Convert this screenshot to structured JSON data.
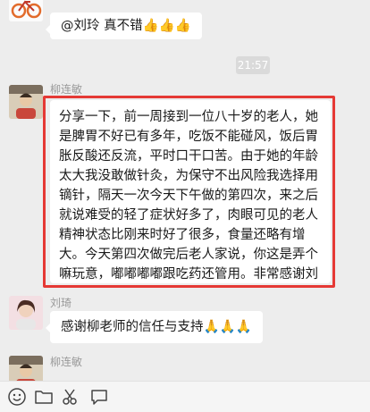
{
  "messages": [
    {
      "sender": "",
      "text": "@刘玲 真不错👍👍👍"
    },
    {
      "sender": "柳连敏",
      "text": "分享一下，前一周接到一位八十岁的老人，她是脾胃不好已有多年，吃饭不能碰风，饭后胃胀反酸还反流，平时口干口苦。由于她的年龄太大我没敢做针灸，为保守不出风险我选择用镝针，隔天一次今天下午做的第四次，来之后就说难受的轻了症状好多了，肉眼可见的老人精神状态比刚来时好了很多，食量还略有增大。今天第四次做完后老人家说，你这是弄个嘛玩意，嘟嘟嘟嘟跟吃药还管用。非常感谢刘琦老师教的技术。现在是拿起这根针心里就底气十足。"
    },
    {
      "sender": "刘琦",
      "text": "感谢柳老师的信任与支持🙏🙏🙏"
    },
    {
      "sender": "柳连敏",
      "text": ""
    }
  ],
  "timestamp": "21:57",
  "toolbar": {
    "items": [
      "emoji-icon",
      "folder-icon",
      "scissors-icon",
      "chat-bubble-icon"
    ]
  },
  "colors": {
    "highlight": "#e53935",
    "background": "#ededed",
    "bubble": "#ffffff"
  }
}
